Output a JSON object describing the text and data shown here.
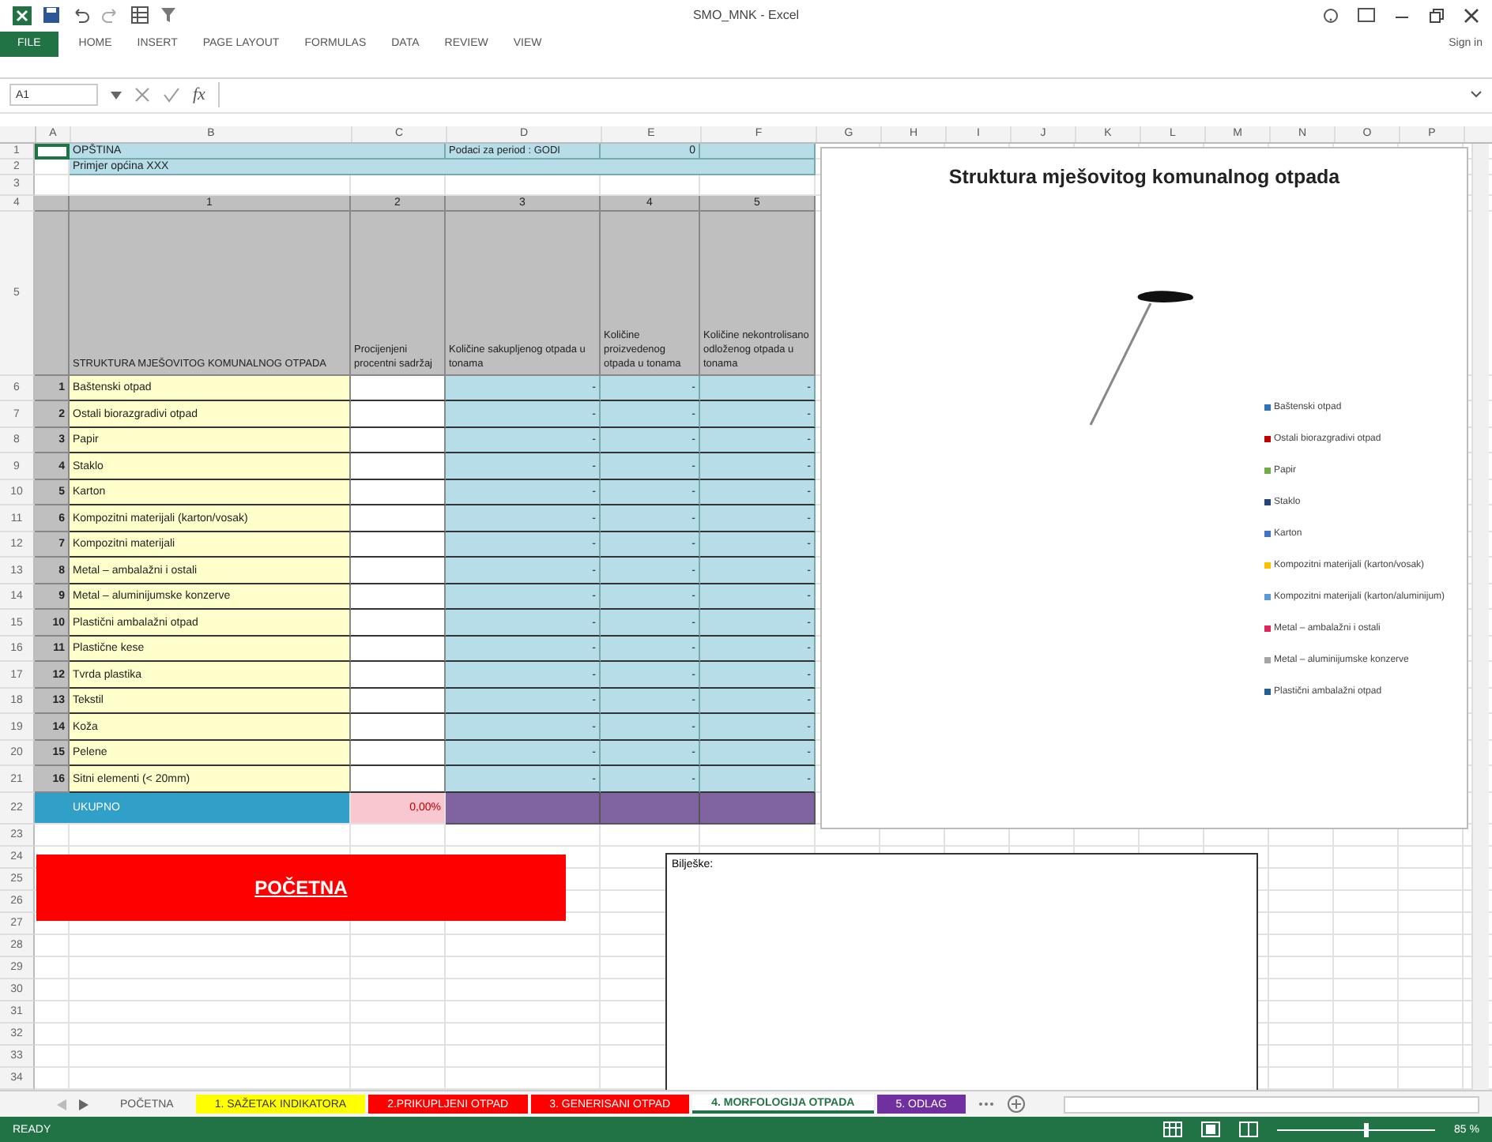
{
  "window": {
    "title": "SMO_MNK - Excel",
    "account": "Sign in"
  },
  "ribbon_tabs": [
    {
      "label": "FILE",
      "kind": "file"
    },
    {
      "label": "HOME",
      "kind": "tab"
    },
    {
      "label": "INSERT",
      "kind": "tab"
    },
    {
      "label": "PAGE LAYOUT",
      "kind": "tab"
    },
    {
      "label": "FORMULAS",
      "kind": "tab"
    },
    {
      "label": "DATA",
      "kind": "tab"
    },
    {
      "label": "REVIEW",
      "kind": "tab"
    },
    {
      "label": "VIEW",
      "kind": "tab"
    }
  ],
  "formula_bar": {
    "name_box": "A1",
    "function_label": "fx"
  },
  "columns": [
    "A",
    "B",
    "C",
    "D",
    "E",
    "F",
    "G",
    "H",
    "I",
    "J",
    "K",
    "L",
    "M",
    "N",
    "O",
    "P"
  ],
  "row_numbers": [
    "1",
    "2",
    "3",
    "4",
    "5",
    "6",
    "7",
    "8",
    "9",
    "10",
    "11",
    "12",
    "13",
    "14",
    "15",
    "16",
    "17",
    "18",
    "19",
    "20",
    "21",
    "22",
    "23",
    "24",
    "25",
    "26",
    "27",
    "28",
    "29",
    "30",
    "31",
    "32",
    "33",
    "34"
  ],
  "sheet": {
    "municipality_label": "OPŠTINA",
    "period_label": "Podaci za period : GODI",
    "period_value": "0",
    "example": "Primjer općina XXX",
    "column_numbers": [
      "1",
      "2",
      "3",
      "4",
      "5"
    ],
    "column_headings": [
      "STRUKTURA MJEŠOVITOG KOMUNALNOG OTPADA",
      "Procijenjeni procentni sadržaj",
      "Količine sakupljenog otpada u tonama",
      "Količine proizvedenog otpada u tonama",
      "Količine nekontrolisano odloženog otpada u tonama"
    ],
    "rows": [
      {
        "number": "1",
        "name": "Baštenski otpad",
        "values": [
          "-",
          "-",
          "-"
        ]
      },
      {
        "number": "2",
        "name": "Ostali biorazgradivi otpad",
        "values": [
          "-",
          "-",
          "-"
        ]
      },
      {
        "number": "3",
        "name": "Papir",
        "values": [
          "-",
          "-",
          "-"
        ]
      },
      {
        "number": "4",
        "name": "Staklo",
        "values": [
          "-",
          "-",
          "-"
        ]
      },
      {
        "number": "5",
        "name": "Karton",
        "values": [
          "-",
          "-",
          "-"
        ]
      },
      {
        "number": "6",
        "name": "Kompozitni materijali (karton/vosak)",
        "values": [
          "-",
          "-",
          "-"
        ]
      },
      {
        "number": "7",
        "name": "Kompozitni materijali",
        "values": [
          "-",
          "-",
          "-"
        ]
      },
      {
        "number": "8",
        "name": "Metal – ambalažni i ostali",
        "values": [
          "-",
          "-",
          "-"
        ]
      },
      {
        "number": "9",
        "name": "Metal – aluminijumske konzerve",
        "values": [
          "-",
          "-",
          "-"
        ]
      },
      {
        "number": "10",
        "name": "Plastični ambalažni otpad",
        "values": [
          "-",
          "-",
          "-"
        ]
      },
      {
        "number": "11",
        "name": "Plastične kese",
        "values": [
          "-",
          "-",
          "-"
        ]
      },
      {
        "number": "12",
        "name": "Tvrda plastika",
        "values": [
          "-",
          "-",
          "-"
        ]
      },
      {
        "number": "13",
        "name": "Tekstil",
        "values": [
          "-",
          "-",
          "-"
        ]
      },
      {
        "number": "14",
        "name": "Koža",
        "values": [
          "-",
          "-",
          "-"
        ]
      },
      {
        "number": "15",
        "name": "Pelene",
        "values": [
          "-",
          "-",
          "-"
        ]
      },
      {
        "number": "16",
        "name": "Sitni elementi (< 20mm)",
        "values": [
          "-",
          "-",
          "-"
        ]
      }
    ],
    "total": {
      "label": "UKUPNO",
      "share": "0,00%"
    }
  },
  "chart": {
    "title": "Struktura mješovitog komunalnog otpada",
    "legend": [
      {
        "label": "Baštenski otpad",
        "color": "#2e75b6"
      },
      {
        "label": "Ostali biorazgradivi otpad",
        "color": "#c00000"
      },
      {
        "label": "Papir",
        "color": "#70ad47"
      },
      {
        "label": "Staklo",
        "color": "#264478"
      },
      {
        "label": "Karton",
        "color": "#4472c4"
      },
      {
        "label": "Kompozitni materijali (karton/vosak)",
        "color": "#ffc000"
      },
      {
        "label": "Kompozitni materijali (karton/aluminijum)",
        "color": "#5b9bd5"
      },
      {
        "label": "Metal – ambalažni i ostali",
        "color": "#e0245e"
      },
      {
        "label": "Metal – aluminijumske konzerve",
        "color": "#a5a5a5"
      },
      {
        "label": "Plastični ambalažni otpad",
        "color": "#255e91"
      }
    ]
  },
  "start_button": "POČETNA",
  "notes": {
    "label": "Bilješke:"
  },
  "sheet_tabs": [
    {
      "label": "POČETNA",
      "selected": false
    },
    {
      "label": "1. SAŽETAK INDIKATORA",
      "color": "#ffff00",
      "selected": false
    },
    {
      "label": "2.PRIKUPLJENI OTPAD",
      "color": "#ff0000",
      "selected": false
    },
    {
      "label": "3. GENERISANI OTPAD",
      "color": "#ff0000",
      "selected": false
    },
    {
      "label": "4. MORFOLOGIJA OTPADA",
      "selected": true
    },
    {
      "label": "5. ODLAG",
      "color": "#7030a0",
      "selected": false
    }
  ],
  "status_bar": {
    "status": "READY",
    "zoom": "85 %",
    "zoom_slider": {
      "level": 0.55
    }
  }
}
